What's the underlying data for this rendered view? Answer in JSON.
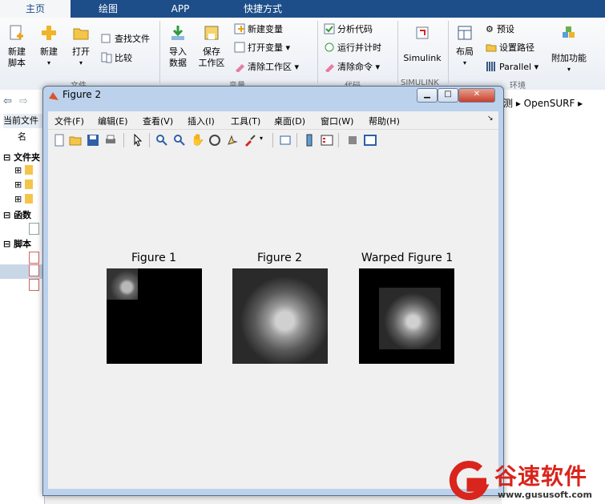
{
  "ribbon_tabs": [
    "主页",
    "绘图",
    "APP",
    "快捷方式"
  ],
  "ribbon": {
    "file": {
      "new_script": "新建\n脚本",
      "new": "新建",
      "open": "打开",
      "find_files": "查找文件",
      "compare": "比较",
      "group": "文件"
    },
    "variable": {
      "import": "导入\n数据",
      "save_ws": "保存\n工作区",
      "new_var": "新建变量",
      "open_var": "打开变量",
      "clear_ws": "清除工作区",
      "group": "变量"
    },
    "code": {
      "analyze": "分析代码",
      "run_time": "运行并计时",
      "clear_cmd": "清除命令",
      "group": "代码"
    },
    "simulink": {
      "label": "Simulink",
      "group": "SIMULINK"
    },
    "env": {
      "layout": "布局",
      "prefs": "预设",
      "set_path": "设置路径",
      "parallel": "Parallel",
      "addons": "附加功能",
      "group": "环境"
    }
  },
  "address": {
    "tail_text": "测 ▸ OpenSURF ▸"
  },
  "left_panel": {
    "current_folder": "当前文件",
    "name_col": "名",
    "folder_section": "文件夹",
    "func_section": "函数",
    "script_section": "脚本"
  },
  "figure_window": {
    "title": "Figure 2",
    "menus": [
      "文件(F)",
      "编辑(E)",
      "查看(V)",
      "插入(I)",
      "工具(T)",
      "桌面(D)",
      "窗口(W)",
      "帮助(H)"
    ],
    "plots": [
      {
        "title": "Figure 1"
      },
      {
        "title": "Figure 2"
      },
      {
        "title": "Warped Figure 1"
      }
    ]
  },
  "watermark": {
    "brand": "谷速软件",
    "url": "www.gususoft.com",
    "brand_color": "#d9251c"
  }
}
